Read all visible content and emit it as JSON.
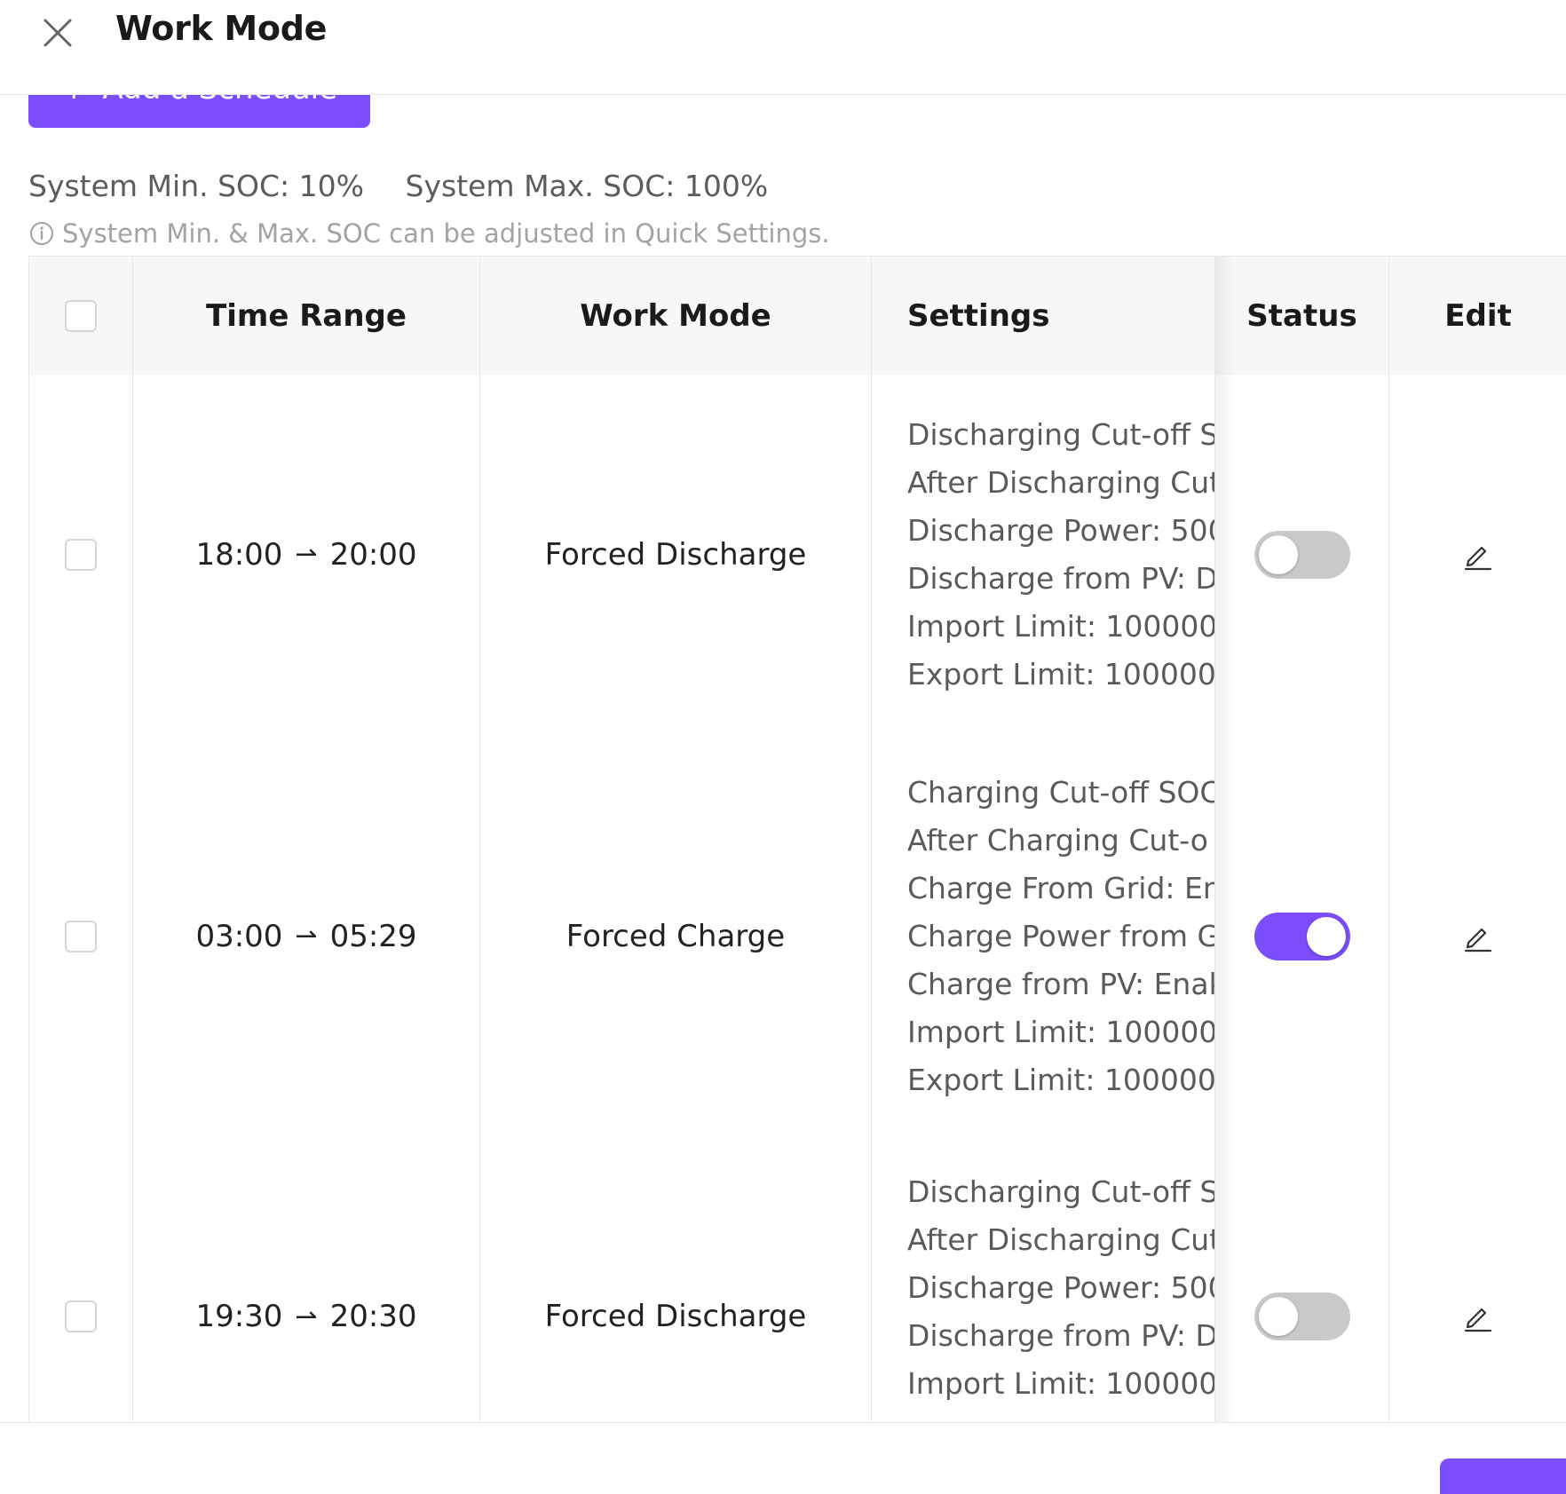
{
  "header": {
    "title": "Work Mode"
  },
  "actions": {
    "add_schedule_label": "Add a Schedule"
  },
  "soc": {
    "min_label": "System Min. SOC: 10%",
    "max_label": "System Max. SOC: 100%",
    "hint": "System Min. & Max. SOC can be adjusted in Quick Settings."
  },
  "table": {
    "headers": {
      "time_range": "Time Range",
      "work_mode": "Work Mode",
      "settings": "Settings",
      "status": "Status",
      "edit": "Edit"
    },
    "rows": [
      {
        "start": "18:00",
        "end": "20:00",
        "mode": "Forced Discharge",
        "settings": [
          "Discharging Cut-off S",
          "After Discharging Cut",
          "Discharge Power: 500",
          "Discharge from PV: D",
          "Import Limit: 100000",
          "Export Limit: 100000"
        ],
        "enabled": false
      },
      {
        "start": "03:00",
        "end": "05:29",
        "mode": "Forced Charge",
        "settings": [
          "Charging Cut-off SOC",
          "After Charging Cut-o",
          "Charge From Grid: En",
          "Charge Power from G",
          "Charge from PV: Enak",
          "Import Limit: 100000",
          "Export Limit: 100000"
        ],
        "enabled": true
      },
      {
        "start": "19:30",
        "end": "20:30",
        "mode": "Forced Discharge",
        "settings": [
          "Discharging Cut-off S",
          "After Discharging Cut",
          "Discharge Power: 500",
          "Discharge from PV: D",
          "Import Limit: 100000"
        ],
        "enabled": false
      }
    ]
  },
  "colors": {
    "accent": "#7b4dfb",
    "toggle_off": "#c9c9c9"
  }
}
